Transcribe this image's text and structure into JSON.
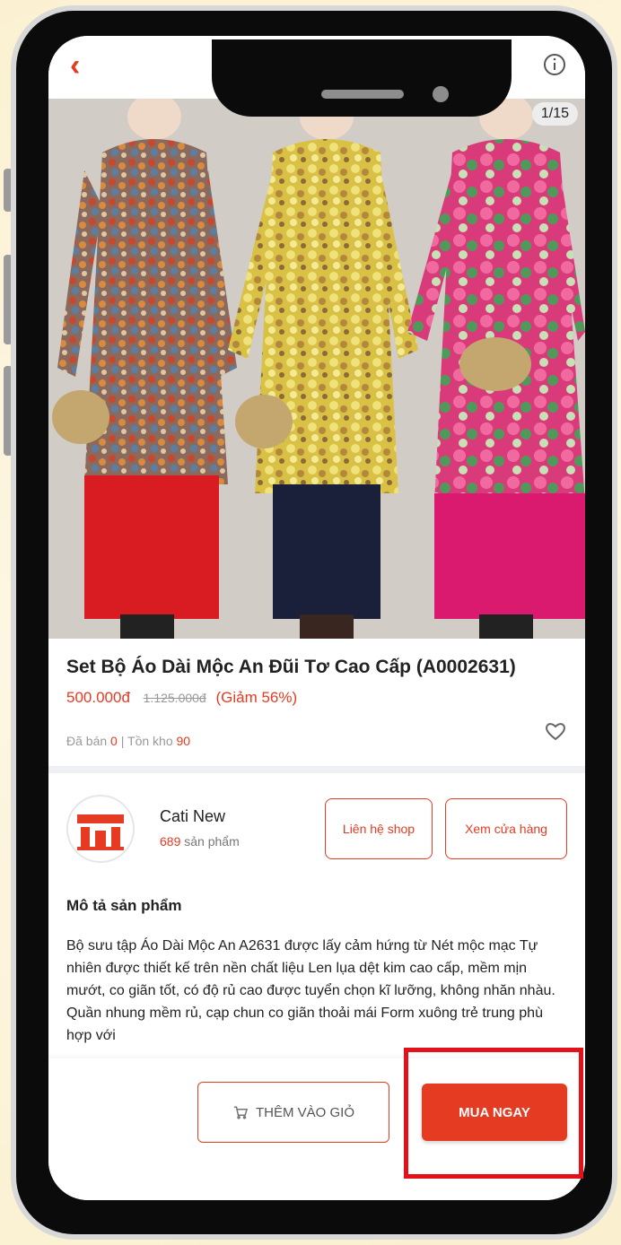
{
  "header": {
    "back_icon": "chevron-left-icon",
    "cart_icon": "cart-icon",
    "info_icon": "info-circle-icon"
  },
  "product": {
    "image_counter": "1/15",
    "title": "Set Bộ Áo Dài Mộc An Đũi Tơ Cao Cấp (A0002631)",
    "price_current": "500.000đ",
    "price_old": "1.125.000đ",
    "discount": "(Giảm 56%)",
    "sold_label": "Đã bán",
    "sold_value": "0",
    "separator": "|",
    "stock_label": "Tồn kho",
    "stock_value": "90"
  },
  "shop": {
    "name": "Cati New",
    "product_count": "689",
    "product_count_label": "sản phẩm",
    "contact_button": "Liên hệ shop",
    "store_button": "Xem cửa hàng"
  },
  "description": {
    "title": "Mô tả sản phẩm",
    "text": "Bộ sưu tập Áo Dài Mộc An A2631 được lấy cảm hứng từ Nét mộc mạc Tự nhiên được thiết kế trên nền chất liệu Len lụa dệt kim cao cấp, mềm mịn mướt, co giãn tốt, có độ rủ cao được tuyển chọn kĩ lưỡng, không nhăn nhàu. Quần nhung mềm rủ, cạp chun co giãn thoải mái Form xuông trẻ trung phù hợp với"
  },
  "actions": {
    "add_to_cart": "THÊM VÀO GIỎ",
    "buy_now": "MUA NGAY"
  },
  "colors": {
    "accent": "#e43b22",
    "highlight": "#e2111a"
  }
}
